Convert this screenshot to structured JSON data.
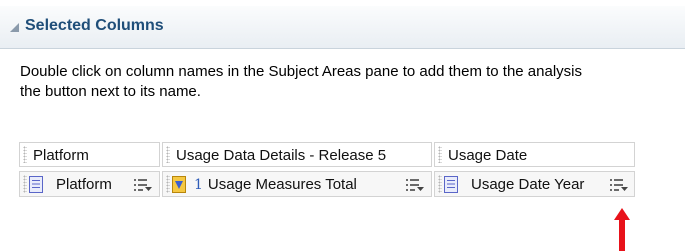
{
  "panel": {
    "title": "Selected Columns",
    "instructions": "Double click on column names in the Subject Areas pane to add them to the analysis\nthe button next to its name."
  },
  "columns": [
    {
      "folder": "Platform",
      "name": "Platform",
      "number": "",
      "icon": "column-icon"
    },
    {
      "folder": "Usage Data Details - Release 5",
      "name": "Usage Measures Total",
      "number": "1",
      "icon": "measure-icon"
    },
    {
      "folder": "Usage Date",
      "name": "Usage Date Year",
      "number": "",
      "icon": "column-icon"
    }
  ],
  "colors": {
    "header_title": "#1f4e79",
    "annotation_arrow": "#e8121a",
    "number_link": "#2f5cb8"
  }
}
